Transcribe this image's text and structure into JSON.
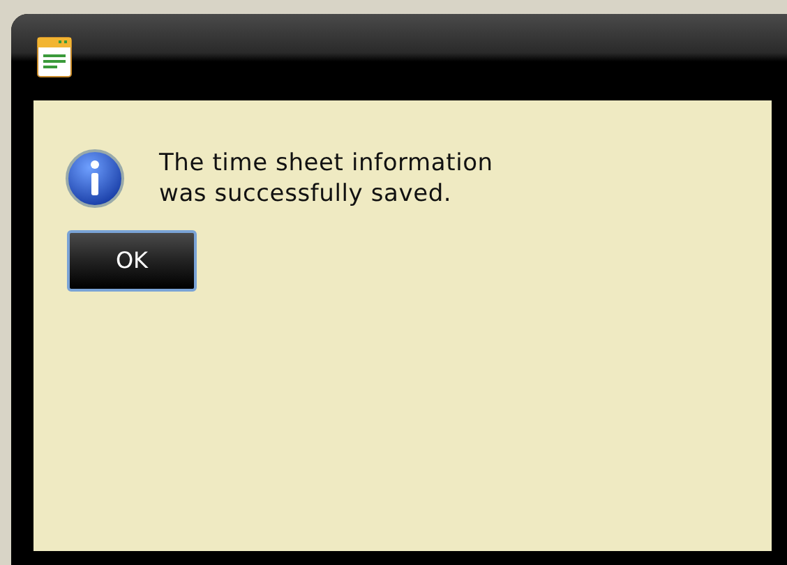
{
  "dialog": {
    "message": "The time sheet information\nwas successfully saved.",
    "buttons": [
      {
        "label": "OK",
        "focused": true
      }
    ]
  }
}
